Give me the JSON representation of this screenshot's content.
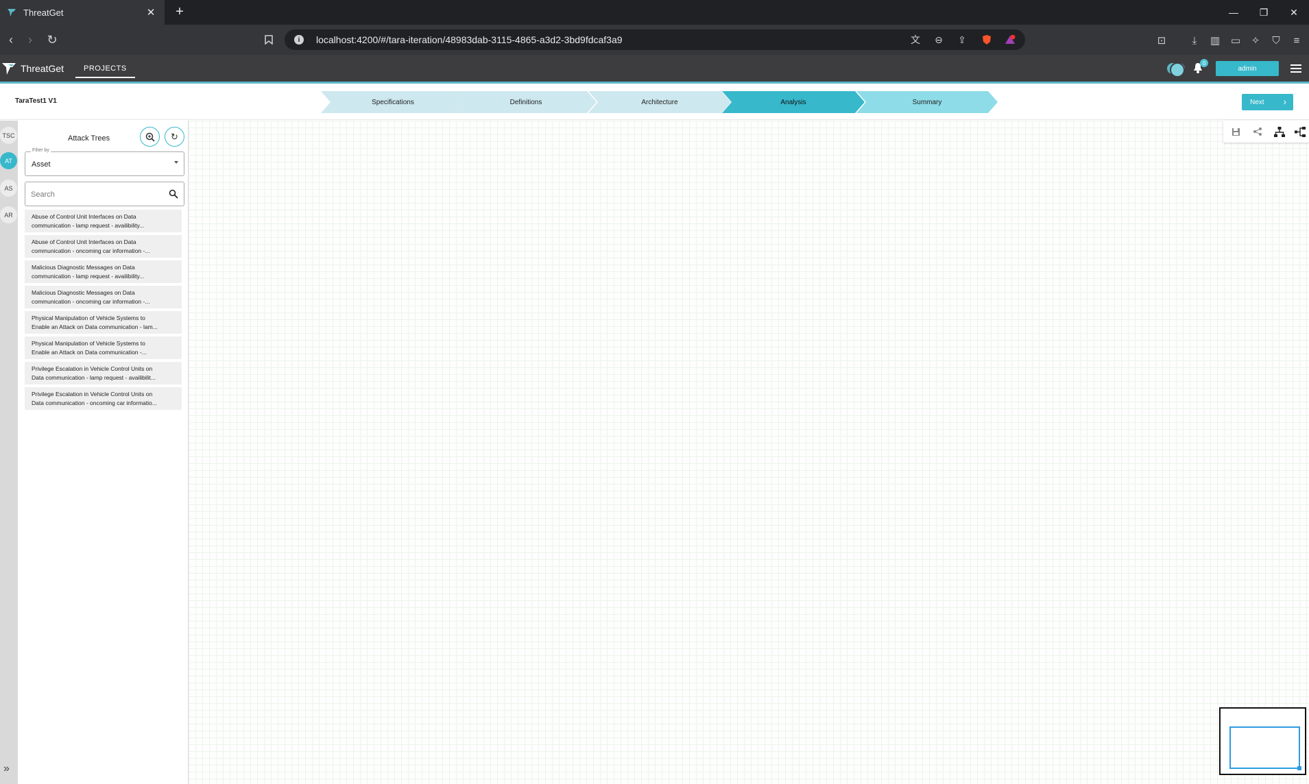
{
  "browser": {
    "tab_title": "ThreatGet",
    "url": "localhost:4200/#/tara-iteration/48983dab-3115-4865-a3d2-3bd9fdcaf3a9"
  },
  "app": {
    "name": "ThreatGet",
    "nav_projects": "PROJECTS",
    "notification_count": "0",
    "user_label": "admin",
    "accent_color": "#37b8cb"
  },
  "iteration": {
    "title": "TaraTest1 V1",
    "steps": [
      {
        "label": "Specifications",
        "state": "done"
      },
      {
        "label": "Definitions",
        "state": "done"
      },
      {
        "label": "Architecture",
        "state": "done"
      },
      {
        "label": "Analysis",
        "state": "active"
      },
      {
        "label": "Summary",
        "state": "upcoming"
      }
    ],
    "next_label": "Next"
  },
  "rail": {
    "items": [
      "TSC",
      "AT",
      "AS",
      "AR"
    ],
    "active": "AT"
  },
  "panel": {
    "title": "Attack Trees",
    "filter_label": "Filter by",
    "filter_value": "Asset",
    "search_placeholder": "Search",
    "items": [
      {
        "line1": "Abuse of Control Unit Interfaces on Data",
        "line2": "communication - lamp request - availibility..."
      },
      {
        "line1": "Abuse of Control Unit Interfaces on Data",
        "line2": "communication - oncoming car information -..."
      },
      {
        "line1": "Malicious Diagnostic Messages on Data",
        "line2": "communication - lamp request - availibility..."
      },
      {
        "line1": "Malicious Diagnostic Messages on Data",
        "line2": "communication - oncoming car information -..."
      },
      {
        "line1": "Physical Manipulation of Vehicle Systems to",
        "line2": "Enable an Attack on Data communication - lam..."
      },
      {
        "line1": "Physical Manipulation of Vehicle Systems to",
        "line2": "Enable an Attack on Data communication -..."
      },
      {
        "line1": "Privilege Escalation in Vehicle Control Units on",
        "line2": "Data communication - lamp request - availibilit..."
      },
      {
        "line1": "Privilege Escalation in Vehicle Control Units on",
        "line2": "Data communication - oncoming car informatio..."
      }
    ]
  },
  "canvas_tools": [
    "save-icon",
    "share-icon",
    "hierarchy-layout-icon",
    "horizontal-layout-icon"
  ]
}
